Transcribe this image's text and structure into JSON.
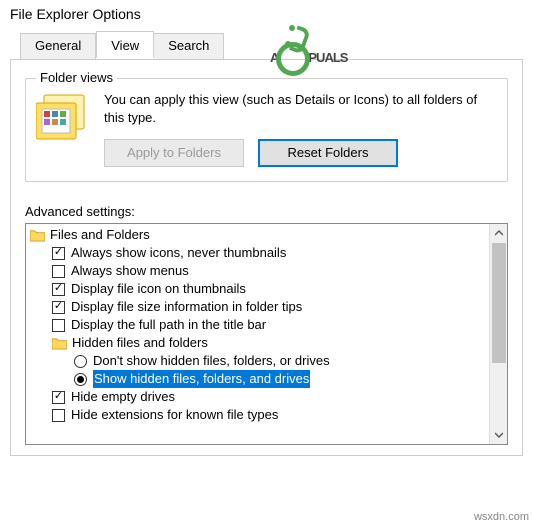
{
  "window": {
    "title": "File Explorer Options"
  },
  "tabs": {
    "general": "General",
    "view": "View",
    "search": "Search"
  },
  "folder_views": {
    "group_label": "Folder views",
    "description": "You can apply this view (such as Details or Icons) to all folders of this type.",
    "apply_btn": "Apply to Folders",
    "reset_btn": "Reset Folders"
  },
  "advanced": {
    "label": "Advanced settings:",
    "root": "Files and Folders",
    "items": {
      "always_icons": "Always show icons, never thumbnails",
      "always_menus": "Always show menus",
      "file_icon_thumb": "Display file icon on thumbnails",
      "file_size_tips": "Display file size information in folder tips",
      "full_path_title": "Display the full path in the title bar",
      "hidden_group": "Hidden files and folders",
      "dont_show_hidden": "Don't show hidden files, folders, or drives",
      "show_hidden": "Show hidden files, folders, and drives",
      "hide_empty": "Hide empty drives",
      "hide_ext": "Hide extensions for known file types"
    }
  },
  "watermark": {
    "pre": "A",
    "post": "PUALS"
  },
  "source": "wsxdn.com"
}
